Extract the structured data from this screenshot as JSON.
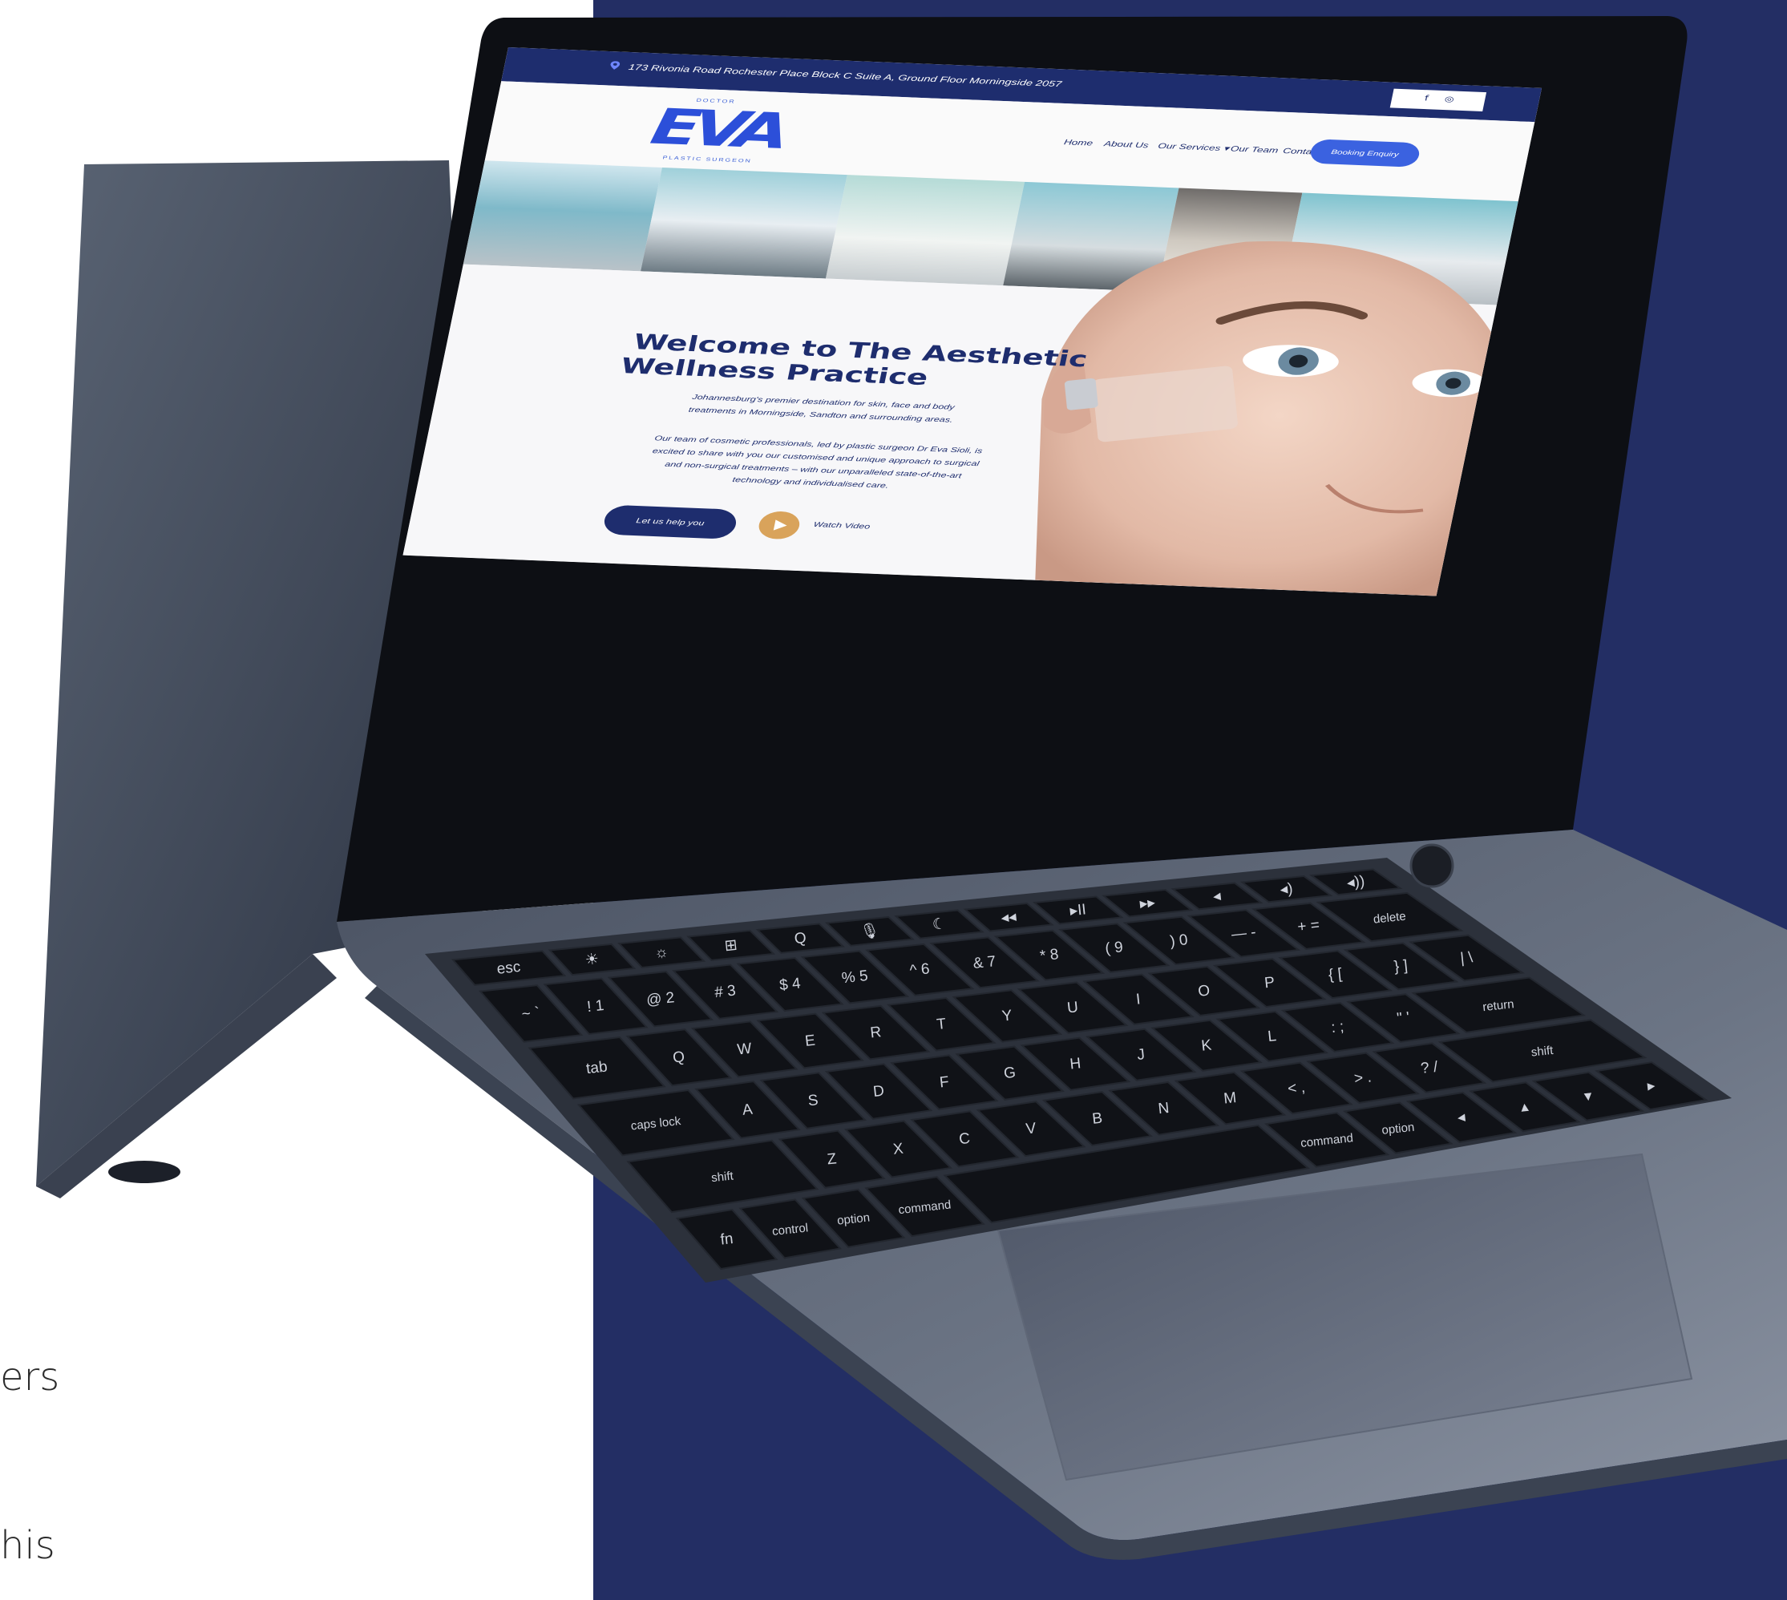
{
  "side_text": {
    "line1": "ers",
    "line2": "his"
  },
  "site": {
    "address": "173 Rivonia Road Rochester Place Block C Suite A, Ground Floor Morningside 2057",
    "social": {
      "facebook": "f",
      "instagram": "◎"
    },
    "logo": {
      "top": "DOCTOR",
      "main": "EVA",
      "bottom": "PLASTIC SURGEON"
    },
    "nav": [
      {
        "label": "Home"
      },
      {
        "label": "About Us"
      },
      {
        "label": "Our Services ▾"
      },
      {
        "label": "Our Team"
      },
      {
        "label": "Contact Us"
      }
    ],
    "booking_label": "Booking Enquiry",
    "hero": {
      "title_line1": "Welcome to The Aesthetic",
      "title_line2": "Wellness Practice",
      "para1": "Johannesburg's premier destination for skin, face and body treatments in Morningside, Sandton and surrounding areas.",
      "para2": "Our team of cosmetic professionals, led by plastic surgeon Dr Eva Sioli, is excited to share with you our customised and unique approach to surgical and non-surgical treatments – with our unparalleled state-of-the-art technology and individualised care.",
      "cta_label": "Let us help you",
      "video_label": "Watch Video"
    }
  },
  "keyboard": {
    "row_fn": [
      "esc",
      "☀",
      "☼",
      "⊞",
      "Q",
      "🎙",
      "☾",
      "◂◂",
      "▸II",
      "▸▸",
      "◂",
      "◂)",
      "◂))"
    ],
    "row_num": [
      "~\n`",
      "!\n1",
      "@\n2",
      "#\n3",
      "$\n4",
      "%\n5",
      "^\n6",
      "&\n7",
      "*\n8",
      "(\n9",
      ")\n0",
      "—\n-",
      "+\n=",
      "delete"
    ],
    "row_q": [
      "tab",
      "Q",
      "W",
      "E",
      "R",
      "T",
      "Y",
      "U",
      "I",
      "O",
      "P",
      "{\n[",
      "}\n]",
      "|\n\\"
    ],
    "row_a": [
      "caps lock",
      "A",
      "S",
      "D",
      "F",
      "G",
      "H",
      "J",
      "K",
      "L",
      ":\n;",
      "\"\n'",
      "return"
    ],
    "row_z": [
      "shift",
      "Z",
      "X",
      "C",
      "V",
      "B",
      "N",
      "M",
      "<\n,",
      ">\n.",
      "?\n/",
      "shift"
    ],
    "row_bottom": [
      "fn",
      "control",
      "option",
      "command",
      "",
      "command",
      "option",
      "◂",
      "▴",
      "▾",
      "▸"
    ]
  }
}
